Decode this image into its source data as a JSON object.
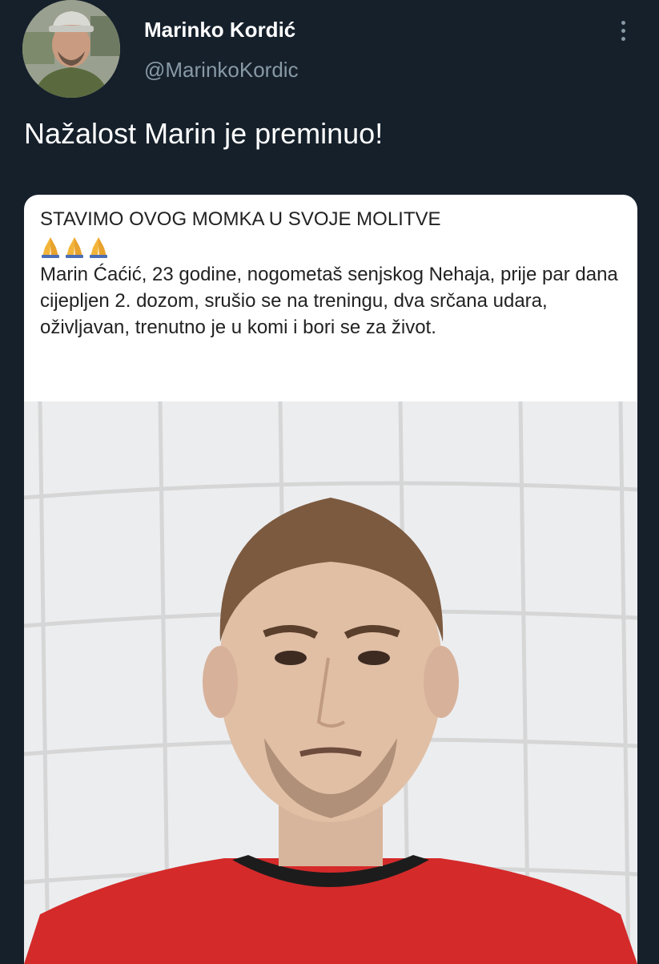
{
  "tweet": {
    "author_name": "Marinko Kordić",
    "author_handle": "@MarinkoKordic",
    "text": "Nažalost Marin je preminuo!"
  },
  "card": {
    "heading": "STAVIMO OVOG MOMKA U SVOJE MOLITVE",
    "emoji_icons": [
      "folded-hands",
      "folded-hands",
      "folded-hands"
    ],
    "body": "Marin Ćaćić, 23 godine, nogometaš senjskog Nehaja, prije par dana cijepljen 2. dozom, srušio se na treningu, dva srčana udara, oživljavan, trenutno je u komi i bori se za život."
  },
  "colors": {
    "background": "#15202b",
    "secondary_text": "#8899a6",
    "card_background": "#ffffff",
    "jersey": "#d42a2a"
  }
}
